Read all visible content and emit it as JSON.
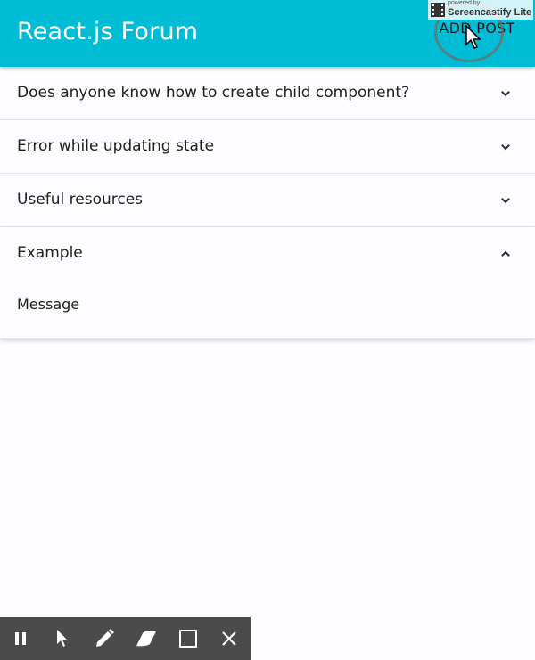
{
  "appbar": {
    "title": "React.js Forum",
    "add_post_label": "ADD POST",
    "color": "#00bcd4"
  },
  "watermark": {
    "powered_by": "powered by",
    "brand": "Screencastify Lite"
  },
  "posts": [
    {
      "title": "Does anyone know how to create child component?",
      "expanded": false
    },
    {
      "title": "Error while updating state",
      "expanded": false
    },
    {
      "title": "Useful resources",
      "expanded": false
    },
    {
      "title": "Example",
      "expanded": true,
      "message": "Message"
    }
  ],
  "recorder_toolbar": {
    "tools": [
      "pause-icon",
      "pointer-icon",
      "pen-icon",
      "eraser-icon",
      "rectangle-icon",
      "close-icon"
    ]
  }
}
